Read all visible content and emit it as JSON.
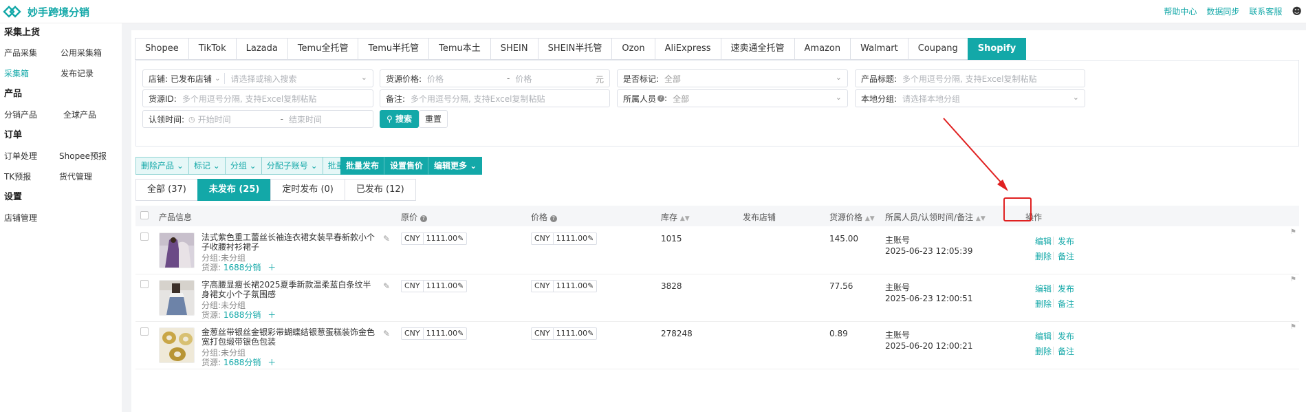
{
  "header": {
    "app_name": "妙手跨境分销",
    "links": [
      "帮助中心",
      "数据同步",
      "联系客服"
    ],
    "accent": "#13a8a8"
  },
  "sidebar": {
    "sections": [
      {
        "title": "采集上货",
        "items": [
          "产品采集",
          "公用采集箱",
          "采集箱",
          "发布记录"
        ]
      },
      {
        "title": "产品",
        "items": [
          "分销产品",
          "全球产品"
        ]
      },
      {
        "title": "订单",
        "items": [
          "订单处理",
          "Shopee预报",
          "TK预报",
          "货代管理"
        ]
      },
      {
        "title": "设置",
        "items": [
          "店铺管理"
        ]
      }
    ],
    "active_item": "采集箱"
  },
  "platform_tabs": [
    "Shopee",
    "TikTok",
    "Lazada",
    "Temu全托管",
    "Temu半托管",
    "Temu本土",
    "SHEIN",
    "SHEIN半托管",
    "Ozon",
    "AliExpress",
    "速卖通全托管",
    "Amazon",
    "Walmart",
    "Coupang",
    "Shopify"
  ],
  "active_platform": "Shopify",
  "filters": {
    "store_label": "店铺:",
    "store_value": "已发布店铺",
    "store_placeholder": "请选择或输入搜索",
    "source_price_label": "货源价格:",
    "price_min_placeholder": "价格",
    "price_max_placeholder": "价格",
    "price_unit": "元",
    "marked_label": "是否标记:",
    "marked_value": "全部",
    "title_label": "产品标题:",
    "title_placeholder": "多个用逗号分隔, 支持Excel复制粘贴",
    "source_id_label": "货源ID:",
    "source_id_placeholder": "多个用逗号分隔, 支持Excel复制粘贴",
    "note_label": "备注:",
    "note_placeholder": "多个用逗号分隔, 支持Excel复制粘贴",
    "owner_label": "所属人员",
    "owner_value": "全部",
    "group_label": "本地分组:",
    "group_placeholder": "请选择本地分组",
    "claim_time_label": "认领时间:",
    "start_placeholder": "开始时间",
    "end_placeholder": "结束时间",
    "range_sep": "-",
    "search_button": "搜索",
    "reset_button": "重置"
  },
  "bulk_actions": {
    "light": [
      "删除产品",
      "标记",
      "分组",
      "分配子账号",
      "批量备注"
    ],
    "dark": [
      "批量发布",
      "设置售价",
      "编辑更多"
    ]
  },
  "status_tabs": [
    "全部 (37)",
    "未发布 (25)",
    "定时发布 (0)",
    "已发布 (12)"
  ],
  "active_status": "未发布 (25)",
  "table": {
    "headers": {
      "info": "产品信息",
      "orig_price": "原价",
      "price": "价格",
      "stock": "库存",
      "store": "发布店铺",
      "source_price": "货源价格",
      "owner": "所属人员/认领时间/备注",
      "ops": "操作"
    },
    "meta_group_label": "分组:",
    "meta_source_label": "货源:",
    "rows": [
      {
        "title": "法式紫色重工蕾丝长袖连衣裙女装早春新款小个子收腰衬衫裙子",
        "group": "未分组",
        "source": "1688分销",
        "orig_currency": "CNY",
        "orig_amount": "1111.00",
        "currency": "CNY",
        "amount": "1111.00",
        "stock": "1015",
        "source_price": "145.00",
        "owner": "主账号",
        "time": "2025-06-23 12:05:39"
      },
      {
        "title": "字高腰显瘦长裙2025夏季新款温柔蓝白条纹半身裙女小个子氛围感",
        "group": "未分组",
        "source": "1688分销",
        "orig_currency": "CNY",
        "orig_amount": "1111.00",
        "currency": "CNY",
        "amount": "1111.00",
        "stock": "3828",
        "source_price": "77.56",
        "owner": "主账号",
        "time": "2025-06-23 12:00:51"
      },
      {
        "title": "金葱丝带银丝金银彩带蝴蝶结银葱蛋糕装饰金色宽打包缎带银色包装",
        "group": "未分组",
        "source": "1688分销",
        "orig_currency": "CNY",
        "orig_amount": "1111.00",
        "currency": "CNY",
        "amount": "1111.00",
        "stock": "278248",
        "source_price": "0.89",
        "owner": "主账号",
        "time": "2025-06-20 12:00:21"
      }
    ],
    "actions": {
      "edit": "编辑",
      "publish": "发布",
      "delete": "删除",
      "note": "备注"
    }
  }
}
